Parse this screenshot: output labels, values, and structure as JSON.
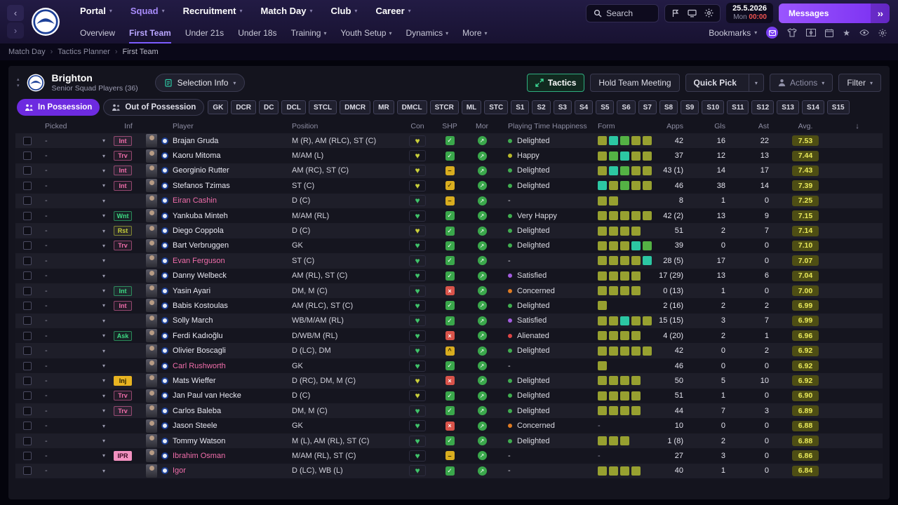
{
  "topbar": {
    "menus": [
      {
        "label": "Portal"
      },
      {
        "label": "Squad",
        "active": true
      },
      {
        "label": "Recruitment"
      },
      {
        "label": "Match Day"
      },
      {
        "label": "Club"
      },
      {
        "label": "Career"
      }
    ],
    "search_label": "Search",
    "date": "25.5.2026",
    "day": "Mon",
    "time": "00:00",
    "messages_label": "Messages"
  },
  "subnav": {
    "items": [
      {
        "label": "Overview"
      },
      {
        "label": "First Team",
        "active": true
      },
      {
        "label": "Under 21s"
      },
      {
        "label": "Under 18s"
      },
      {
        "label": "Training",
        "chevron": true
      },
      {
        "label": "Youth Setup",
        "chevron": true
      },
      {
        "label": "Dynamics",
        "chevron": true
      },
      {
        "label": "More",
        "chevron": true
      }
    ],
    "bookmarks_label": "Bookmarks"
  },
  "breadcrumb": {
    "items": [
      "Match Day",
      "Tactics Planner",
      "First Team"
    ]
  },
  "header": {
    "club_name": "Brighton",
    "subtitle": "Senior Squad Players (36)",
    "selection_info_label": "Selection Info",
    "tactics_label": "Tactics",
    "hold_team_meeting_label": "Hold Team Meeting",
    "quick_pick_label": "Quick Pick",
    "actions_label": "Actions",
    "filter_label": "Filter"
  },
  "filters": {
    "in_possession_label": "In Possession",
    "out_of_possession_label": "Out of Possession",
    "chips": [
      "GK",
      "DCR",
      "DC",
      "DCL",
      "STCL",
      "DMCR",
      "MR",
      "DMCL",
      "STCR",
      "ML",
      "STC",
      "S1",
      "S2",
      "S3",
      "S4",
      "S5",
      "S6",
      "S7",
      "S8",
      "S9",
      "S10",
      "S11",
      "S12",
      "S13",
      "S14",
      "S15"
    ]
  },
  "table": {
    "columns": [
      "Picked",
      "Inf",
      "Player",
      "Position",
      "Con",
      "SHP",
      "Mor",
      "Playing Time Happiness",
      "Form",
      "Apps",
      "Gls",
      "Ast",
      "Avg."
    ],
    "rows": [
      {
        "picked": "-",
        "inf": "Int",
        "inf_style": "pink",
        "name": "Brajan Gruda",
        "pink": false,
        "pos": "M (R), AM (RLC), ST (C)",
        "con": "yellow",
        "shp": "check",
        "happy": "Delighted",
        "happy_color": "green",
        "form": [
          "o",
          "t",
          "g",
          "o",
          "o"
        ],
        "apps": "42",
        "gls": "16",
        "ast": "22",
        "avg": "7.53"
      },
      {
        "picked": "-",
        "inf": "Trv",
        "inf_style": "pink",
        "name": "Kaoru Mitoma",
        "pink": false,
        "pos": "M/AM (L)",
        "con": "yellow",
        "shp": "check",
        "happy": "Happy",
        "happy_color": "yellow",
        "form": [
          "o",
          "g",
          "t",
          "o",
          "o"
        ],
        "apps": "37",
        "gls": "12",
        "ast": "13",
        "avg": "7.44"
      },
      {
        "picked": "-",
        "inf": "Int",
        "inf_style": "pink",
        "name": "Georginio Rutter",
        "pink": false,
        "pos": "AM (RC), ST (C)",
        "con": "yellow",
        "shp": "minus",
        "happy": "Delighted",
        "happy_color": "green",
        "form": [
          "o",
          "t",
          "g",
          "o",
          "o"
        ],
        "apps": "43 (1)",
        "gls": "14",
        "ast": "17",
        "avg": "7.43"
      },
      {
        "picked": "-",
        "inf": "Int",
        "inf_style": "pink",
        "name": "Stefanos Tzimas",
        "pink": false,
        "pos": "ST (C)",
        "con": "yellow",
        "shp": "ycheck",
        "happy": "Delighted",
        "happy_color": "green",
        "form": [
          "t",
          "o",
          "g",
          "o",
          "o"
        ],
        "apps": "46",
        "gls": "38",
        "ast": "14",
        "avg": "7.39"
      },
      {
        "picked": "-",
        "inf": null,
        "name": "Eiran Cashin",
        "pink": true,
        "pos": "D (C)",
        "con": "green",
        "shp": "minus",
        "happy": "-",
        "happy_color": "none",
        "form": [
          "o",
          "o"
        ],
        "apps": "8",
        "gls": "1",
        "ast": "0",
        "avg": "7.25"
      },
      {
        "picked": "-",
        "inf": "Wnt",
        "inf_style": "green",
        "name": "Yankuba Minteh",
        "pink": false,
        "pos": "M/AM (RL)",
        "con": "green",
        "shp": "check",
        "happy": "Very Happy",
        "happy_color": "green",
        "form": [
          "o",
          "o",
          "o",
          "o",
          "o"
        ],
        "apps": "42 (2)",
        "gls": "13",
        "ast": "9",
        "avg": "7.15"
      },
      {
        "picked": "-",
        "inf": "Rst",
        "inf_style": "olive",
        "name": "Diego Coppola",
        "pink": false,
        "pos": "D (C)",
        "con": "yellow",
        "shp": "check",
        "happy": "Delighted",
        "happy_color": "green",
        "form": [
          "o",
          "o",
          "o",
          "o"
        ],
        "apps": "51",
        "gls": "2",
        "ast": "7",
        "avg": "7.14"
      },
      {
        "picked": "-",
        "inf": "Trv",
        "inf_style": "pink",
        "name": "Bart Verbruggen",
        "pink": false,
        "pos": "GK",
        "con": "green",
        "shp": "check",
        "happy": "Delighted",
        "happy_color": "green",
        "form": [
          "o",
          "o",
          "o",
          "t",
          "g"
        ],
        "apps": "39",
        "gls": "0",
        "ast": "0",
        "avg": "7.10"
      },
      {
        "picked": "-",
        "inf": null,
        "name": "Evan Ferguson",
        "pink": true,
        "pos": "ST (C)",
        "con": "green",
        "shp": "check",
        "happy": "-",
        "happy_color": "none",
        "form": [
          "o",
          "o",
          "o",
          "o",
          "t"
        ],
        "apps": "28 (5)",
        "gls": "17",
        "ast": "0",
        "avg": "7.07"
      },
      {
        "picked": "-",
        "inf": null,
        "name": "Danny Welbeck",
        "pink": false,
        "pos": "AM (RL), ST (C)",
        "con": "green",
        "shp": "check",
        "happy": "Satisfied",
        "happy_color": "purple",
        "form": [
          "o",
          "o",
          "o",
          "o"
        ],
        "apps": "17 (29)",
        "gls": "13",
        "ast": "6",
        "avg": "7.04"
      },
      {
        "picked": "-",
        "inf": "Int",
        "inf_style": "green",
        "name": "Yasin Ayari",
        "pink": false,
        "pos": "DM, M (C)",
        "con": "green",
        "shp": "cross",
        "happy": "Concerned",
        "happy_color": "orange",
        "form": [
          "o",
          "o",
          "o",
          "o"
        ],
        "apps": "0 (13)",
        "gls": "1",
        "ast": "0",
        "avg": "7.00"
      },
      {
        "picked": "-",
        "inf": "Int",
        "inf_style": "pink",
        "name": "Babis Kostoulas",
        "pink": false,
        "pos": "AM (RLC), ST (C)",
        "con": "green",
        "shp": "check",
        "happy": "Delighted",
        "happy_color": "green",
        "form": [
          "o"
        ],
        "apps": "2 (16)",
        "gls": "2",
        "ast": "2",
        "avg": "6.99"
      },
      {
        "picked": "-",
        "inf": null,
        "name": "Solly March",
        "pink": false,
        "pos": "WB/M/AM (RL)",
        "con": "green",
        "shp": "check",
        "happy": "Satisfied",
        "happy_color": "purple",
        "form": [
          "o",
          "o",
          "t",
          "o",
          "o"
        ],
        "apps": "15 (15)",
        "gls": "3",
        "ast": "7",
        "avg": "6.99"
      },
      {
        "picked": "-",
        "inf": "Ask",
        "inf_style": "green",
        "name": "Ferdi Kadıoğlu",
        "pink": false,
        "pos": "D/WB/M (RL)",
        "con": "green",
        "shp": "cross",
        "happy": "Alienated",
        "happy_color": "red",
        "form": [
          "o",
          "o",
          "o",
          "o"
        ],
        "apps": "4 (20)",
        "gls": "2",
        "ast": "1",
        "avg": "6.96"
      },
      {
        "picked": "-",
        "inf": null,
        "name": "Olivier Boscagli",
        "pink": false,
        "pos": "D (LC), DM",
        "con": "green",
        "shp": "yup",
        "happy": "Delighted",
        "happy_color": "green",
        "form": [
          "o",
          "o",
          "o",
          "o",
          "o"
        ],
        "apps": "42",
        "gls": "0",
        "ast": "2",
        "avg": "6.92"
      },
      {
        "picked": "-",
        "inf": null,
        "name": "Carl Rushworth",
        "pink": true,
        "pos": "GK",
        "con": "green",
        "shp": "check",
        "happy": "-",
        "happy_color": "none",
        "form": [
          "o"
        ],
        "apps": "46",
        "gls": "0",
        "ast": "0",
        "avg": "6.92"
      },
      {
        "picked": "-",
        "inf": "Inj",
        "inf_style": "inj",
        "name": "Mats Wieffer",
        "pink": false,
        "pos": "D (RC), DM, M (C)",
        "con": "yellow",
        "shp": "cross",
        "happy": "Delighted",
        "happy_color": "green",
        "form": [
          "o",
          "o",
          "o",
          "o"
        ],
        "apps": "50",
        "gls": "5",
        "ast": "10",
        "avg": "6.92"
      },
      {
        "picked": "-",
        "inf": "Trv",
        "inf_style": "pink",
        "name": "Jan Paul van Hecke",
        "pink": false,
        "pos": "D (C)",
        "con": "yellow",
        "shp": "check",
        "happy": "Delighted",
        "happy_color": "green",
        "form": [
          "o",
          "o",
          "o",
          "o"
        ],
        "apps": "51",
        "gls": "1",
        "ast": "0",
        "avg": "6.90"
      },
      {
        "picked": "-",
        "inf": "Trv",
        "inf_style": "pink",
        "name": "Carlos Baleba",
        "pink": false,
        "pos": "DM, M (C)",
        "con": "green",
        "shp": "check",
        "happy": "Delighted",
        "happy_color": "green",
        "form": [
          "o",
          "o",
          "o",
          "o"
        ],
        "apps": "44",
        "gls": "7",
        "ast": "3",
        "avg": "6.89"
      },
      {
        "picked": "-",
        "inf": null,
        "name": "Jason Steele",
        "pink": false,
        "pos": "GK",
        "con": "green",
        "shp": "cross",
        "happy": "Concerned",
        "happy_color": "orange",
        "form": null,
        "apps": "10",
        "gls": "0",
        "ast": "0",
        "avg": "6.88"
      },
      {
        "picked": "-",
        "inf": null,
        "name": "Tommy Watson",
        "pink": false,
        "pos": "M (L), AM (RL), ST (C)",
        "con": "green",
        "shp": "check",
        "happy": "Delighted",
        "happy_color": "green",
        "form": [
          "o",
          "o",
          "o"
        ],
        "apps": "1 (8)",
        "gls": "2",
        "ast": "0",
        "avg": "6.88"
      },
      {
        "picked": "-",
        "inf": "IPR",
        "inf_style": "ipr",
        "name": "Ibrahim Osman",
        "pink": true,
        "pos": "M/AM (RL), ST (C)",
        "con": "green",
        "shp": "minus",
        "happy": "-",
        "happy_color": "none",
        "form": null,
        "apps": "27",
        "gls": "3",
        "ast": "0",
        "avg": "6.86"
      },
      {
        "picked": "-",
        "inf": null,
        "name": "Igor",
        "pink": true,
        "pos": "D (LC), WB (L)",
        "con": "green",
        "shp": "check",
        "happy": "-",
        "happy_color": "none",
        "form": [
          "o",
          "o",
          "o",
          "o"
        ],
        "apps": "40",
        "gls": "1",
        "ast": "0",
        "avg": "6.84"
      }
    ]
  }
}
